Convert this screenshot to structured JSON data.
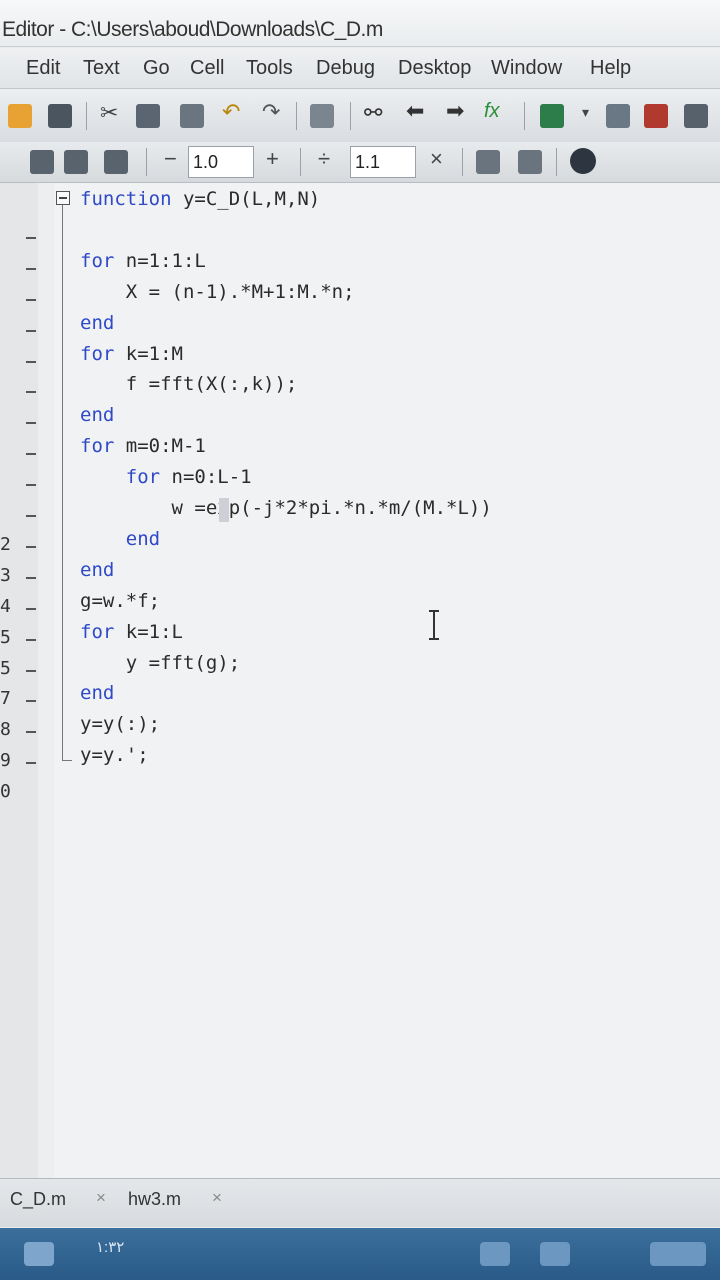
{
  "window": {
    "title": "Editor - C:\\Users\\aboud\\Downloads\\C_D.m"
  },
  "menu": [
    "Edit",
    "Text",
    "Go",
    "Cell",
    "Tools",
    "Debug",
    "Desktop",
    "Window",
    "Help"
  ],
  "toolbar": {
    "cell_minus": "−",
    "cell_value": "1.0",
    "cell_plus": "+",
    "divide": "÷",
    "scale_value": "1.1",
    "times": "×",
    "fx_label": "fx"
  },
  "editor": {
    "line_numbers": [
      "",
      "",
      "",
      "",
      "",
      "",
      "",
      "",
      "",
      "",
      "",
      "2",
      "3",
      "4",
      "5",
      "5",
      "7",
      "8",
      "9",
      "0"
    ],
    "code": [
      {
        "k": "function",
        "t": " y=C_D(L,M,N)"
      },
      {
        "k": "",
        "t": ""
      },
      {
        "k": "for",
        "t": " n=1:1:L"
      },
      {
        "k": "",
        "t": "    X = (n-1).*M+1:M.*n;"
      },
      {
        "k": "end",
        "t": ""
      },
      {
        "k": "for",
        "t": " k=1:M"
      },
      {
        "k": "",
        "t": "    f =fft(X(:,k));"
      },
      {
        "k": "end",
        "t": ""
      },
      {
        "k": "for",
        "t": " m=0:M-1"
      },
      {
        "k": "    for",
        "t": " n=0:L-1"
      },
      {
        "k": "",
        "t": "        w =exp(-j*2*pi.*n.*m/(M.*L))"
      },
      {
        "k": "    end",
        "t": ""
      },
      {
        "k": "end",
        "t": ""
      },
      {
        "k": "",
        "t": "g=w.*f;"
      },
      {
        "k": "for",
        "t": " k=1:L"
      },
      {
        "k": "",
        "t": "    y =fft(g);"
      },
      {
        "k": "end",
        "t": ""
      },
      {
        "k": "",
        "t": "y=y(:);"
      },
      {
        "k": "",
        "t": "y=y.';"
      }
    ]
  },
  "tabs": [
    {
      "label": "C_D.m",
      "close": "×"
    },
    {
      "label": "hw3.m",
      "close": "×"
    }
  ],
  "taskbar": {
    "clock": "١:٣٢"
  },
  "colors": {
    "keyword": "#2f49c7",
    "text": "#2b2b2b",
    "editor_bg": "#f1f2f3"
  }
}
